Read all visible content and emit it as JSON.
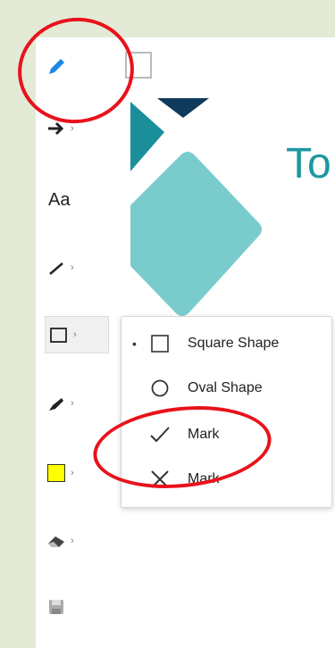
{
  "colors": {
    "background": "#e3ead6",
    "panel": "#ffffff",
    "accent_teal": "#1d97a2",
    "navy": "#0f3a5c",
    "highlight": "#e8121b",
    "yellow": "#ffff00"
  },
  "toolbar": {
    "items": [
      {
        "name": "pen-icon",
        "chevron": false
      },
      {
        "name": "arrow-icon",
        "chevron": true
      },
      {
        "name": "text-icon",
        "label": "Aa",
        "chevron": false
      },
      {
        "name": "line-icon",
        "chevron": true
      },
      {
        "name": "shape-icon",
        "chevron": true,
        "selected": true
      },
      {
        "name": "marker-icon",
        "chevron": true
      },
      {
        "name": "color-swatch-icon",
        "chevron": true
      },
      {
        "name": "eraser-icon",
        "chevron": true
      },
      {
        "name": "save-icon",
        "chevron": false
      }
    ],
    "chevron_glyph": "›",
    "text_label": "Aa"
  },
  "canvas": {
    "title_fragment": "To"
  },
  "shape_menu": {
    "items": [
      {
        "label": "Square Shape",
        "icon": "square-icon",
        "selected": true
      },
      {
        "label": "Oval Shape",
        "icon": "circle-icon",
        "selected": false
      },
      {
        "label": "Mark",
        "icon": "checkmark-icon",
        "selected": false
      },
      {
        "label": "Mark",
        "icon": "x-mark-icon",
        "selected": false
      }
    ],
    "selected_bullet": "•"
  }
}
